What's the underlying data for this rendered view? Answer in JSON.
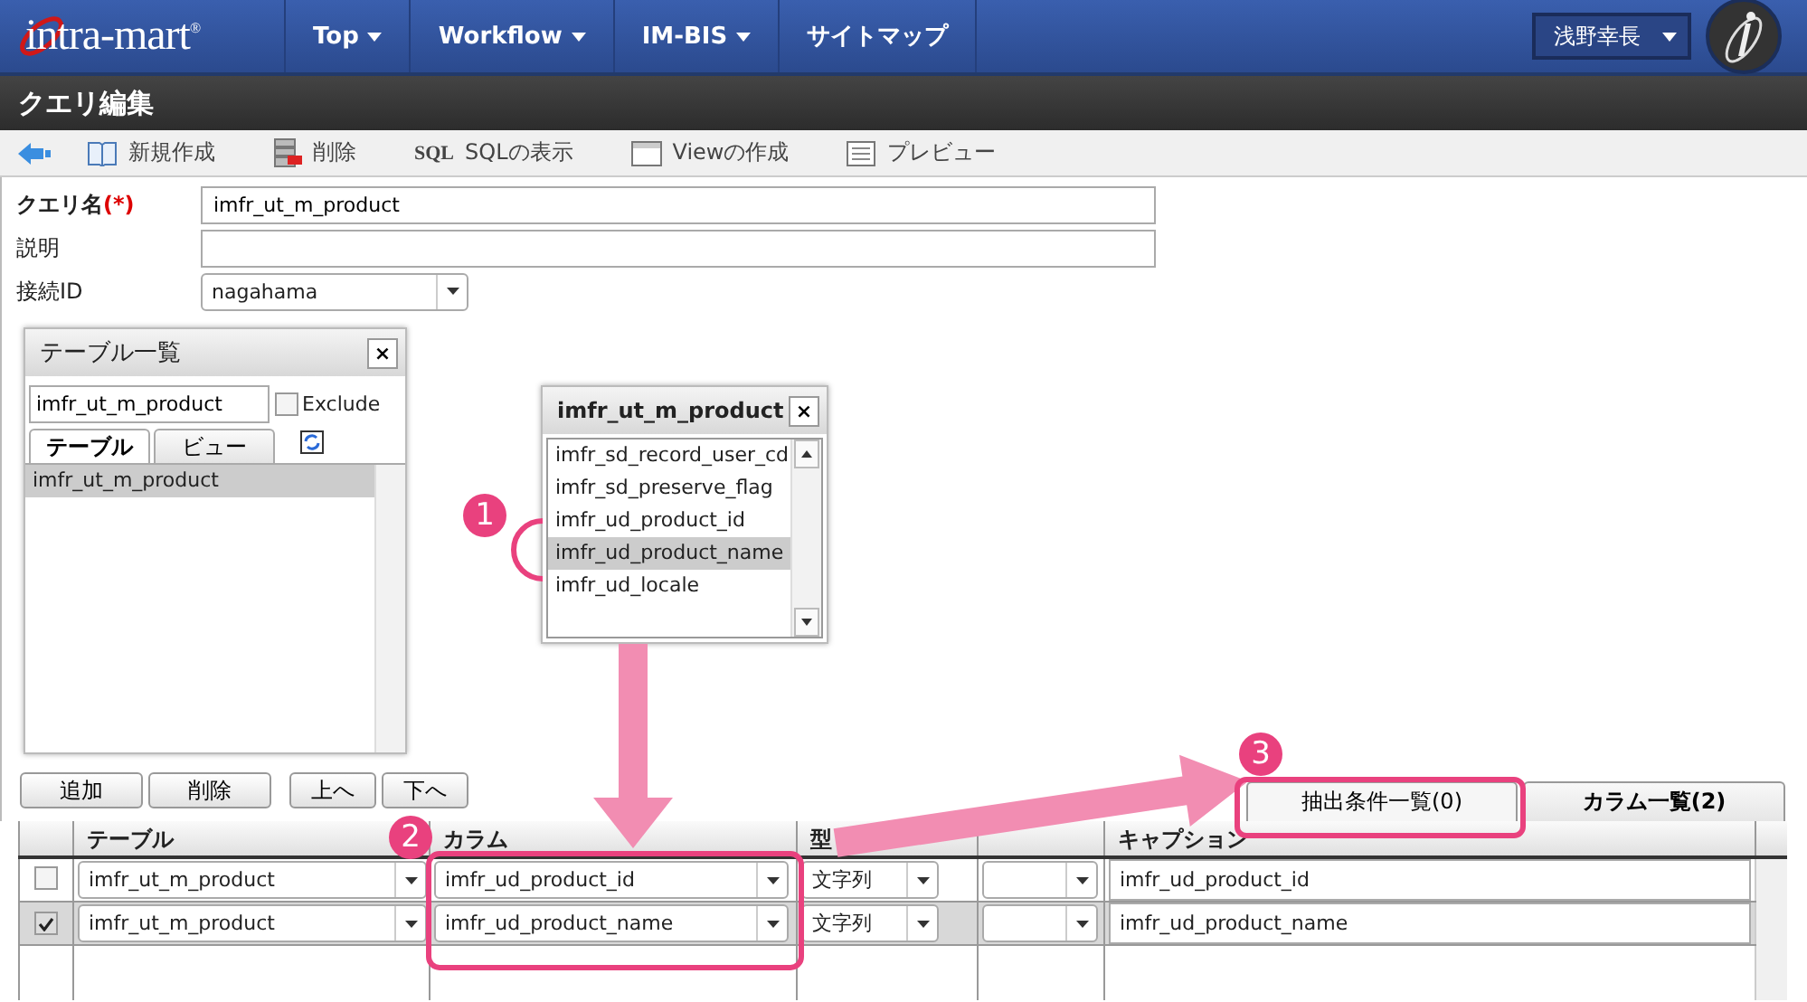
{
  "header": {
    "logo": "intra-mart$^{®}$",
    "nav": [
      {
        "label": "Top",
        "dropdown": true
      },
      {
        "label": "Workflow",
        "dropdown": true
      },
      {
        "label": "IM-BIS",
        "dropdown": true
      },
      {
        "label": "サイトマップ",
        "dropdown": false
      }
    ],
    "user": "浅野幸長"
  },
  "page_title": "クエリ編集",
  "toolbar": [
    {
      "kind": "new",
      "label": "新規作成"
    },
    {
      "kind": "delete",
      "label": "削除"
    },
    {
      "kind": "sql",
      "badge": "SQL",
      "label": "SQLの表示"
    },
    {
      "kind": "view",
      "label": "Viewの作成"
    },
    {
      "kind": "preview",
      "label": "プレビュー"
    }
  ],
  "form": [
    {
      "kind": "text",
      "label": "クエリ名",
      "required_mark": "(*)",
      "value": "imfr_ut_m_product"
    },
    {
      "kind": "text",
      "label": "説明"
    },
    {
      "kind": "select",
      "label": "接続ID",
      "value": "nagahama"
    }
  ],
  "table_list": {
    "title": "テーブル一覧",
    "close": "×",
    "filter": "imfr_ut_m_product",
    "exclude": {
      "label": "Exclude",
      "checked": false
    },
    "tabs": [
      {
        "label": "テーブル",
        "selected": true
      },
      {
        "label": "ビュー",
        "selected": false
      }
    ],
    "items": [
      {
        "label": "imfr_ut_m_product",
        "selected": true
      }
    ]
  },
  "column_popup": {
    "title": "imfr_ut_m_product",
    "close": "×",
    "items": [
      {
        "label": "imfr_sd_record_user_cd",
        "selected": false
      },
      {
        "label": "imfr_sd_preserve_flag",
        "selected": false
      },
      {
        "label": "imfr_ud_product_id",
        "selected": false
      },
      {
        "label": "imfr_ud_product_name",
        "selected": true
      },
      {
        "label": "imfr_ud_locale",
        "selected": false
      }
    ]
  },
  "button_groups": [
    [
      "追加",
      "削除"
    ],
    [
      "上へ",
      "下へ"
    ]
  ],
  "tabs": [
    {
      "label": "抽出条件一覧(0)",
      "selected": false
    },
    {
      "label": "カラム一覧(2)",
      "selected": true
    }
  ],
  "grid": {
    "columns": [
      {
        "label": "テーブル"
      },
      {
        "label": "カラム"
      },
      {
        "label": "型"
      },
      {},
      {
        "label": "キャプション"
      }
    ],
    "rows": [
      {
        "checked": false,
        "table": "imfr_ut_m_product",
        "column": "imfr_ud_product_id",
        "type": "文字列",
        "caption": "imfr_ud_product_id"
      },
      {
        "checked": true,
        "table": "imfr_ut_m_product",
        "column": "imfr_ud_product_name",
        "type": "文字列",
        "caption": "imfr_ud_product_name"
      }
    ]
  },
  "callouts": [
    "1",
    "2",
    "3"
  ]
}
